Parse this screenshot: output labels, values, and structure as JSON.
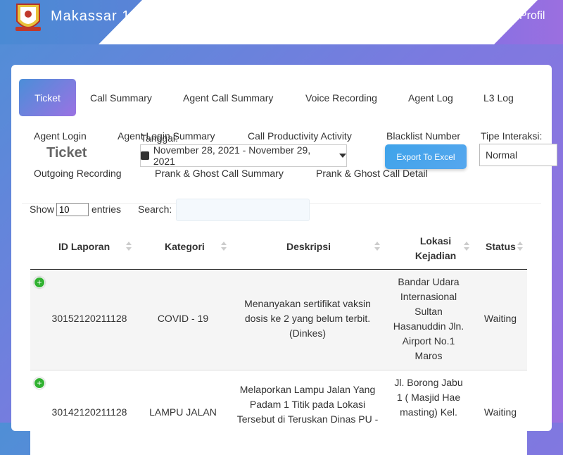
{
  "header": {
    "brand": "Makassar 1",
    "profil_label": "Profil",
    "logo_icon": "city-crest-logo"
  },
  "tabs": [
    {
      "label": "Ticket",
      "active": true
    },
    {
      "label": "Call Summary"
    },
    {
      "label": "Agent Call Summary"
    },
    {
      "label": "Voice Recording"
    },
    {
      "label": "Agent Log"
    },
    {
      "label": "L3 Log"
    },
    {
      "label": "Agent Login"
    },
    {
      "label": "Agent Login Summary"
    },
    {
      "label": "Call Productivity Activity"
    },
    {
      "label": "Blacklist Number"
    },
    {
      "label": "Outgoing Recording"
    },
    {
      "label": "Prank & Ghost Call Summary"
    },
    {
      "label": "Prank & Ghost Call Detail"
    }
  ],
  "page_title": "Ticket",
  "filters": {
    "tanggal_label": "Tanggal:",
    "date_range": "November 28, 2021 - November 29, 2021",
    "export_label": "Export To Excel",
    "tipe_label": "Tipe Interaksi:",
    "tipe_value": "Normal"
  },
  "table_controls": {
    "show_label": "Show",
    "show_value": "10",
    "entries_label": "entries",
    "search_label": "Search:"
  },
  "table": {
    "headers": [
      "ID Laporan",
      "Kategori",
      "Deskripsi",
      "Lokasi Kejadian",
      "Status"
    ],
    "rows": [
      {
        "id": "30152120211128",
        "kategori": "COVID - 19",
        "deskripsi": "Menanyakan sertifikat vaksin dosis ke 2 yang belum terbit. (Dinkes)",
        "lokasi": "Bandar Udara Internasional Sultan Hasanuddin Jln. Airport No.1 Maros",
        "status": "Waiting"
      },
      {
        "id": "30142120211128",
        "kategori": "LAMPU JALAN",
        "deskripsi": "Melaporkan Lampu Jalan Yang Padam 1 Titik pada Lokasi Tersebut di Teruskan Dinas PU -",
        "lokasi": "Jl. Borong Jabu 1 ( Masjid Hae masting) Kel.",
        "status": "Waiting"
      }
    ]
  },
  "colors": {
    "accent_start": "#4b8ed8",
    "accent_end": "#9b72e3",
    "expand_green": "#31b131",
    "export_blue": "#3fa3ea"
  }
}
